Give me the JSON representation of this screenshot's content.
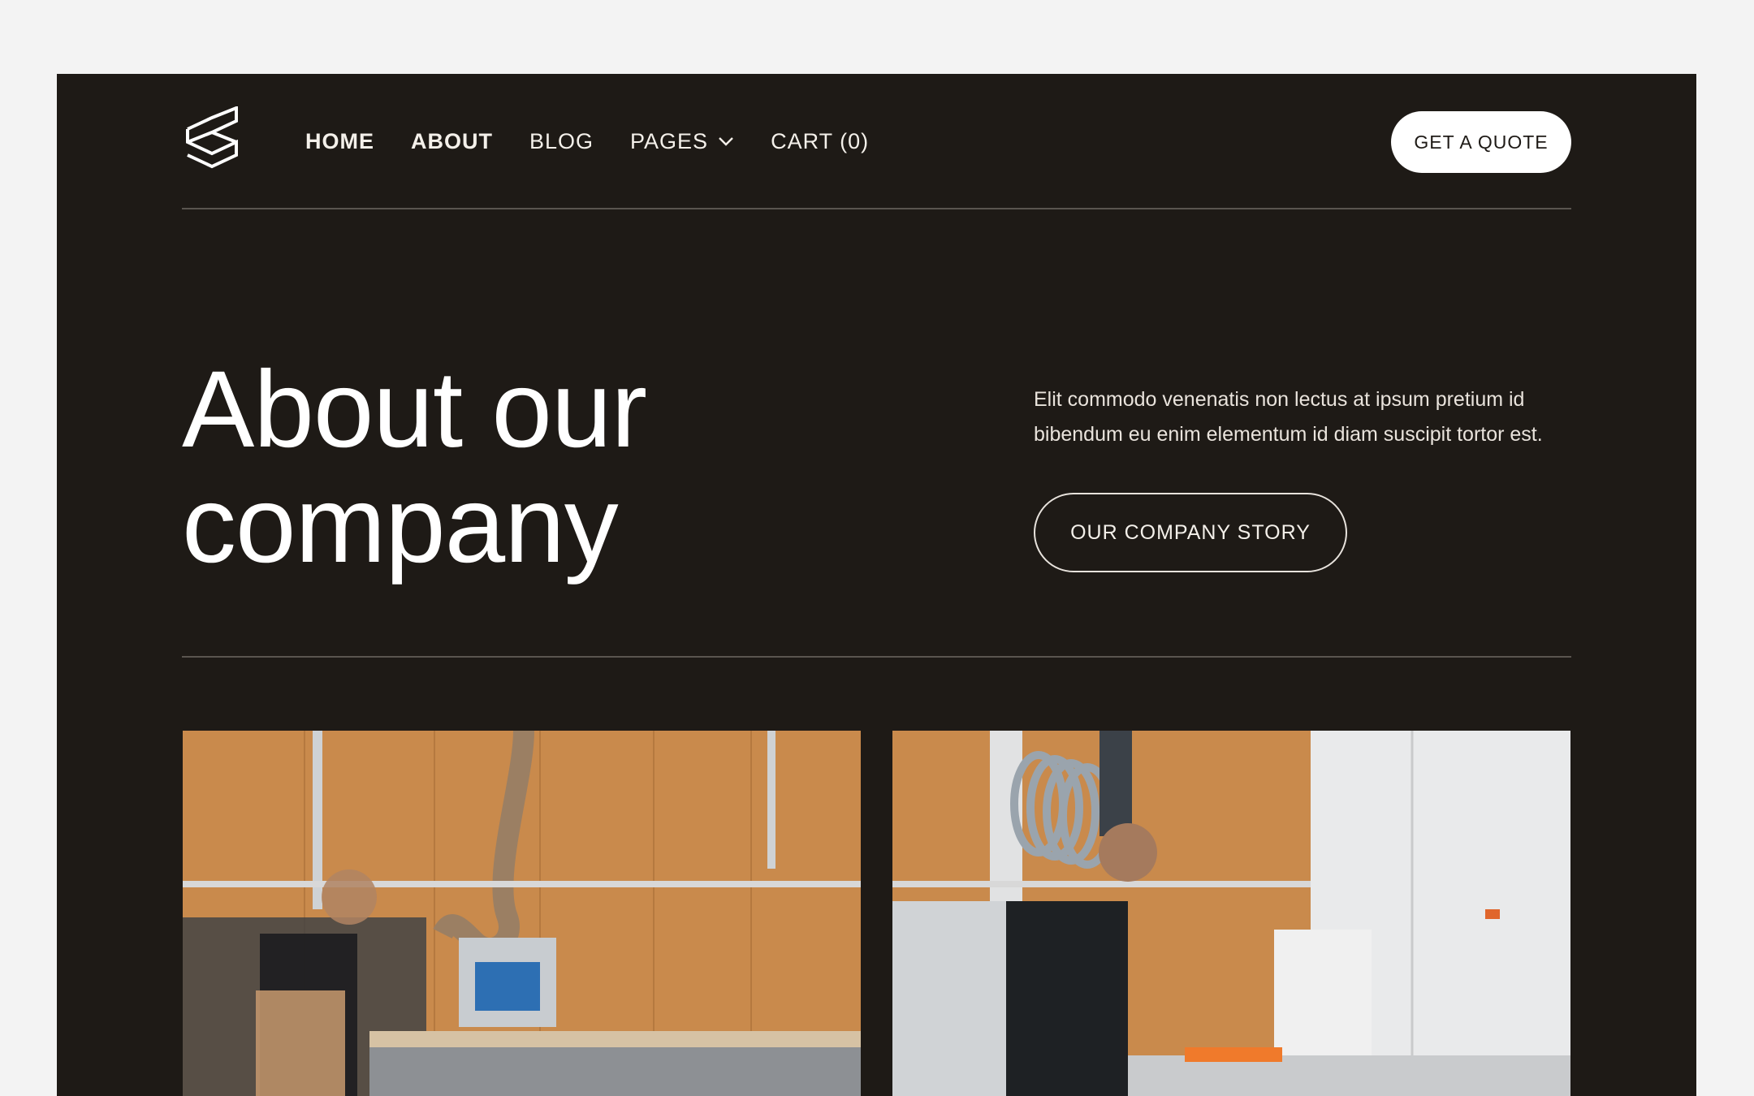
{
  "nav": {
    "links": [
      {
        "label": "HOME"
      },
      {
        "label": "ABOUT"
      },
      {
        "label": "BLOG"
      },
      {
        "label": "PAGES"
      },
      {
        "label": "CART (0)"
      }
    ],
    "cta_label": "GET A QUOTE",
    "pages_icon": "chevron-down-icon",
    "logo_icon": "stacked-boxes-logo-icon"
  },
  "hero": {
    "title_line1": "About our",
    "title_line2": "company",
    "description": "Elit commodo venenatis non lectus at ipsum pretium  id bibendum eu enim elementum id diam suscipit tortor est.",
    "story_button_label": "OUR COMPANY STORY"
  },
  "colors": {
    "page_background": "#f3f3f3",
    "frame_background": "#1e1a16",
    "text": "#ffffff",
    "accent_wood": "#c98a4c"
  }
}
